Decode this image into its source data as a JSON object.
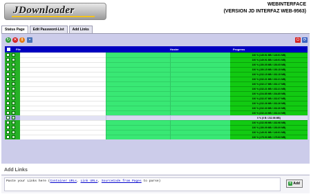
{
  "header": {
    "logo_text": "JDownloader",
    "title_line1": "WEBINTERFACE",
    "title_line2": "(VERSION JD INTERFAZ WEB-9563)"
  },
  "tabs": [
    {
      "label": "Status Page",
      "active": true
    },
    {
      "label": "Edit Password-List",
      "active": false
    },
    {
      "label": "Add Links",
      "active": false
    }
  ],
  "toolbar": {
    "icons": [
      "refresh-icon",
      "stop-icon",
      "pause-icon",
      "save-icon",
      "shutdown-icon",
      "reconnect-icon"
    ]
  },
  "table": {
    "columns": {
      "file": "File",
      "hoster": "Hoster",
      "progress": "Progress"
    },
    "rows": [
      {
        "progress": "100 % (149.91 MB / 149.91 MB)"
      },
      {
        "progress": "100 % (149.91 MB / 149.91 MB)"
      },
      {
        "progress": "100 % (150.05 MB / 150.05 MB)"
      },
      {
        "progress": "100 % (150.15 MB / 150.15 MB)"
      },
      {
        "progress": "100 % (232.15 MB / 232.15 MB)"
      },
      {
        "progress": "100 % (232.21 MB / 232.21 MB)"
      },
      {
        "progress": "100 % (232.17 MB / 232.17 MB)"
      },
      {
        "progress": "100 % (232.21 MB / 232.21 MB)"
      },
      {
        "progress": "100 % (234.85 MB / 234.85 MB)"
      },
      {
        "progress": "100 % (232.07 MB / 232.07 MB)"
      },
      {
        "progress": "100 % (232.26 MB / 232.26 MB)"
      },
      {
        "progress": "100 % (232.30 MB / 232.30 MB)"
      },
      {
        "progress": "100 % (232.24 MB / 232.24 MB)"
      },
      {
        "progress": "0 % (0 B / 232.98 MB)",
        "special": true
      },
      {
        "progress": "100 % (232.98 MB / 232.98 MB)"
      },
      {
        "progress": "100 % (150.09 MB / 150.09 MB)"
      },
      {
        "progress": "100 % (149.91 MB / 149.91 MB)"
      },
      {
        "progress": "100 % (175.93 MB / 175.93 MB)"
      }
    ]
  },
  "controls": {
    "action_select": "activate",
    "go_label": "Go!",
    "max_downloads_label": "Max. Downloads",
    "max_downloads_value": "5",
    "speed_limit_label": "SpeedLimit",
    "speed_limit_value": "0",
    "speed_unit_label": "KB/s (Current: 0 KB/s)",
    "go2_label": "Go!"
  },
  "add_links": {
    "title": "Add Links",
    "text_prefix": "Paste your Links here (",
    "link1": "Container URLs",
    "sep1": ", ",
    "link2": "Link URLs",
    "sep2": ", ",
    "link3": "SourceCode from Pages",
    "suffix": " to parse)",
    "button_label": "Add"
  },
  "colors": {
    "header_bar": "#0000c0",
    "row_green": "#12ca12",
    "panel_bg": "#ccccea"
  }
}
